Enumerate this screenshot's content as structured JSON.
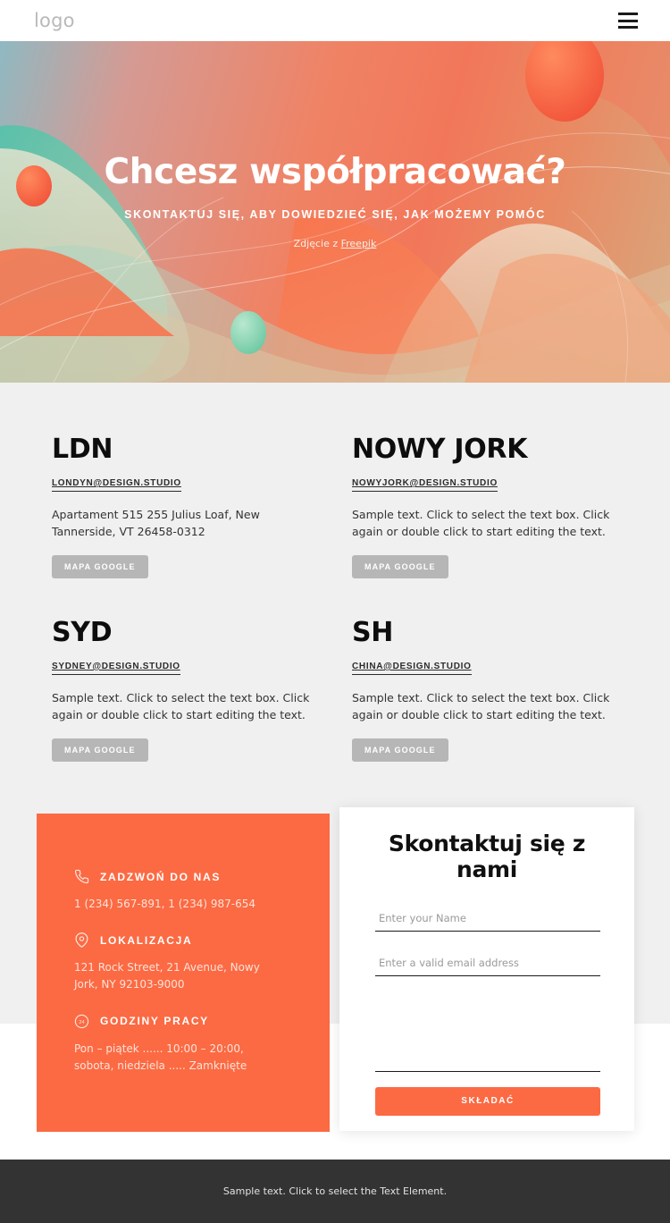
{
  "header": {
    "logo": "logo",
    "menu_icon": "hamburger-menu-icon"
  },
  "hero": {
    "title": "Chcesz współpracować?",
    "subtitle": "SKONTAKTUJ SIĘ, ABY DOWIEDZIEĆ SIĘ, JAK MOŻEMY POMÓC",
    "credit_prefix": "Zdjęcie z ",
    "credit_link": "Freepik"
  },
  "offices": [
    {
      "name": "LDN",
      "email": "LONDYN@DESIGN.STUDIO",
      "description": "Apartament 515 255 Julius Loaf, New Tannerside, VT 26458-0312",
      "button": "MAPA GOOGLE"
    },
    {
      "name": "NOWY JORK",
      "email": "NOWYJORK@DESIGN.STUDIO",
      "description": "Sample text. Click to select the text box. Click again or double click to start editing the text.",
      "button": "MAPA GOOGLE"
    },
    {
      "name": "SYD",
      "email": "SYDNEY@DESIGN.STUDIO",
      "description": "Sample text. Click to select the text box. Click again or double click to start editing the text.",
      "button": "MAPA GOOGLE"
    },
    {
      "name": "SH",
      "email": "CHINA@DESIGN.STUDIO",
      "description": "Sample text. Click to select the text box. Click again or double click to start editing the text.",
      "button": "MAPA GOOGLE"
    }
  ],
  "contact_info": {
    "phone": {
      "icon": "phone-icon",
      "title": "ZADZWOŃ DO NAS",
      "value": "1 (234) 567-891, 1 (234) 987-654"
    },
    "location": {
      "icon": "map-pin-icon",
      "title": "LOKALIZACJA",
      "value": "121 Rock Street, 21 Avenue, Nowy Jork, NY 92103-9000"
    },
    "hours": {
      "icon": "clock-24-icon",
      "title": "GODZINY PRACY",
      "value": "Pon – piątek ...... 10:00 – 20:00, sobota, niedziela ..... Zamknięte"
    }
  },
  "form": {
    "title": "Skontaktuj się z nami",
    "name_placeholder": "Enter your Name",
    "name_value": "",
    "email_placeholder": "Enter a valid email address",
    "email_value": "",
    "message_placeholder": "",
    "message_value": "",
    "submit_label": "SKŁADAĆ"
  },
  "footer": {
    "text": "Sample text. Click to select the Text Element."
  },
  "colors": {
    "accent_orange": "#FB6A43",
    "section_bg": "#F0F0F0",
    "footer_bg": "#333333",
    "button_gray": "#B6B6B6"
  }
}
